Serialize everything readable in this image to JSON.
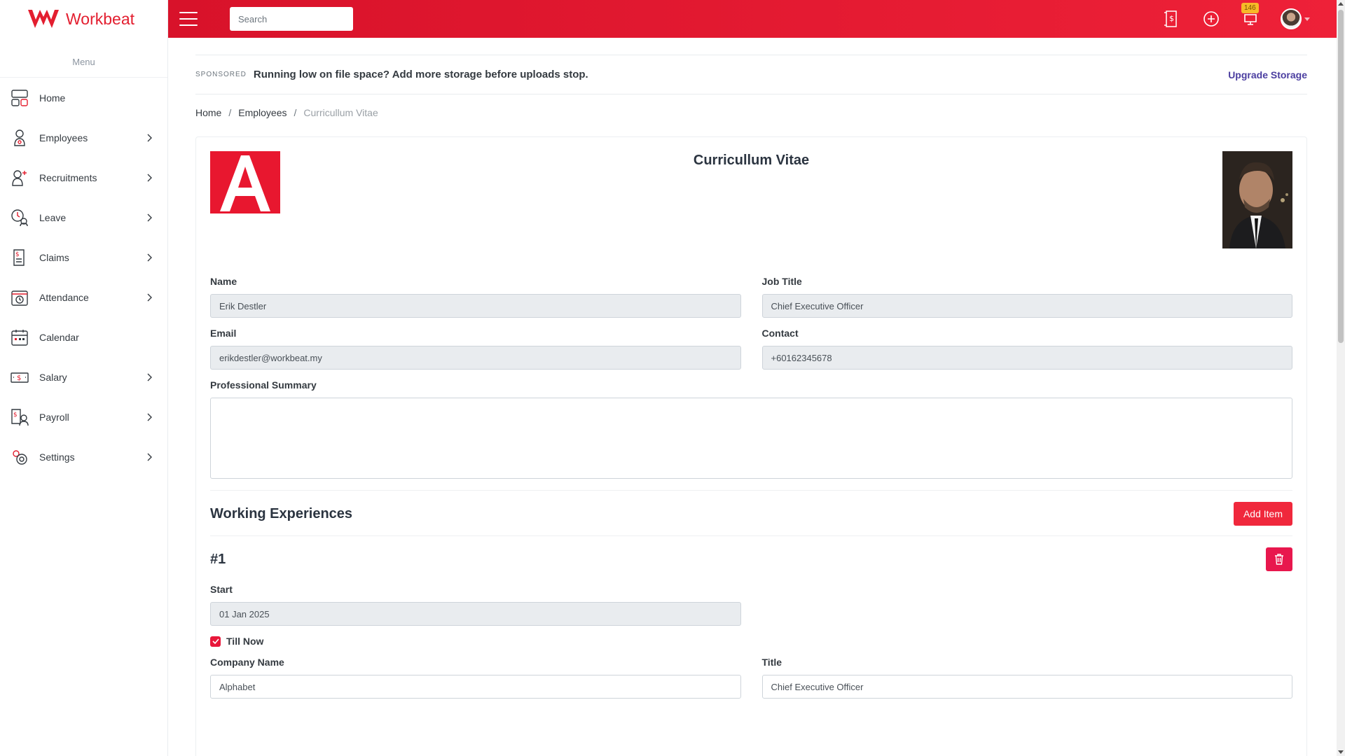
{
  "brand": {
    "name": "Workbeat",
    "color": "#e31e2f"
  },
  "sidebar": {
    "menu_title": "Menu",
    "items": [
      {
        "label": "Home",
        "icon": "home-icon",
        "has_children": false
      },
      {
        "label": "Employees",
        "icon": "employee-icon",
        "has_children": true
      },
      {
        "label": "Recruitments",
        "icon": "recruitment-icon",
        "has_children": true
      },
      {
        "label": "Leave",
        "icon": "leave-icon",
        "has_children": true
      },
      {
        "label": "Claims",
        "icon": "claims-icon",
        "has_children": true
      },
      {
        "label": "Attendance",
        "icon": "attendance-icon",
        "has_children": true
      },
      {
        "label": "Calendar",
        "icon": "calendar-icon",
        "has_children": false
      },
      {
        "label": "Salary",
        "icon": "salary-icon",
        "has_children": true
      },
      {
        "label": "Payroll",
        "icon": "payroll-icon",
        "has_children": true
      },
      {
        "label": "Settings",
        "icon": "settings-icon",
        "has_children": true
      }
    ]
  },
  "topbar": {
    "search_placeholder": "Search",
    "notification_count": "146"
  },
  "sponsor": {
    "tag": "SPONSORED",
    "text": "Running low on file space? Add more storage before uploads stop.",
    "link": "Upgrade Storage"
  },
  "breadcrumb": {
    "home": "Home",
    "employees": "Employees",
    "current": "Curricullum Vitae"
  },
  "cv": {
    "title": "Curricullum Vitae",
    "company_logo_letter": "A",
    "fields": {
      "name_label": "Name",
      "name_value": "Erik Destler",
      "job_title_label": "Job Title",
      "job_title_value": "Chief Executive Officer",
      "email_label": "Email",
      "email_value": "erikdestler@workbeat.my",
      "contact_label": "Contact",
      "contact_value": "+60162345678",
      "summary_label": "Professional Summary",
      "summary_value": ""
    },
    "experiences": {
      "title": "Working Experiences",
      "add_label": "Add Item",
      "items": [
        {
          "number": "#1",
          "start_label": "Start",
          "start_value": "01 Jan 2025",
          "till_now_label": "Till Now",
          "till_now_checked": true,
          "company_label": "Company Name",
          "company_value": "Alphabet",
          "title_label": "Title",
          "title_value": "Chief Executive Officer"
        }
      ]
    }
  }
}
